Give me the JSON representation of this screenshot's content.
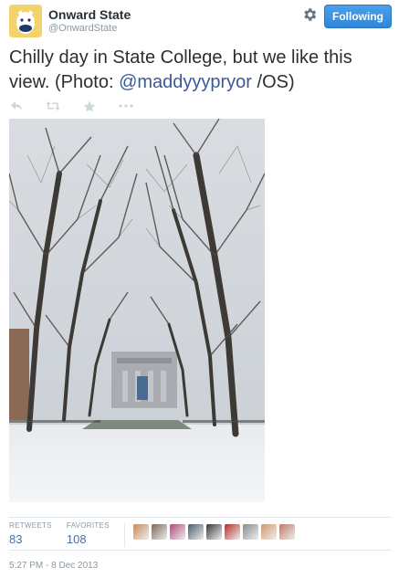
{
  "header": {
    "name": "Onward State",
    "handle": "@OnwardState",
    "follow_label": "Following",
    "follow_color": "#3b94e3"
  },
  "tweet": {
    "text_before": "Chilly day in State College, but we like this view. (Photo: ",
    "mention": "@maddyyypryor",
    "text_after": " /OS)",
    "mention_color": "#3b5998"
  },
  "actions": [
    {
      "name": "reply-icon"
    },
    {
      "name": "retweet-icon"
    },
    {
      "name": "favorite-icon"
    },
    {
      "name": "more-icon"
    }
  ],
  "photo": {
    "subject": "snowy tree-lined walkway with library building"
  },
  "stats": {
    "retweets_label": "RETWEETS",
    "retweets_value": "83",
    "favorites_label": "FAVORITES",
    "favorites_value": "108"
  },
  "favoriters": [
    {
      "color": "#c88a5a"
    },
    {
      "color": "#7a6a5a"
    },
    {
      "color": "#b04a7a"
    },
    {
      "color": "#4a5a6a"
    },
    {
      "color": "#3a3a3a"
    },
    {
      "color": "#b0302a"
    },
    {
      "color": "#8a8a8a"
    },
    {
      "color": "#d09a6a"
    },
    {
      "color": "#c07a6a"
    }
  ],
  "timestamp": "5:27 PM - 8 Dec 2013"
}
